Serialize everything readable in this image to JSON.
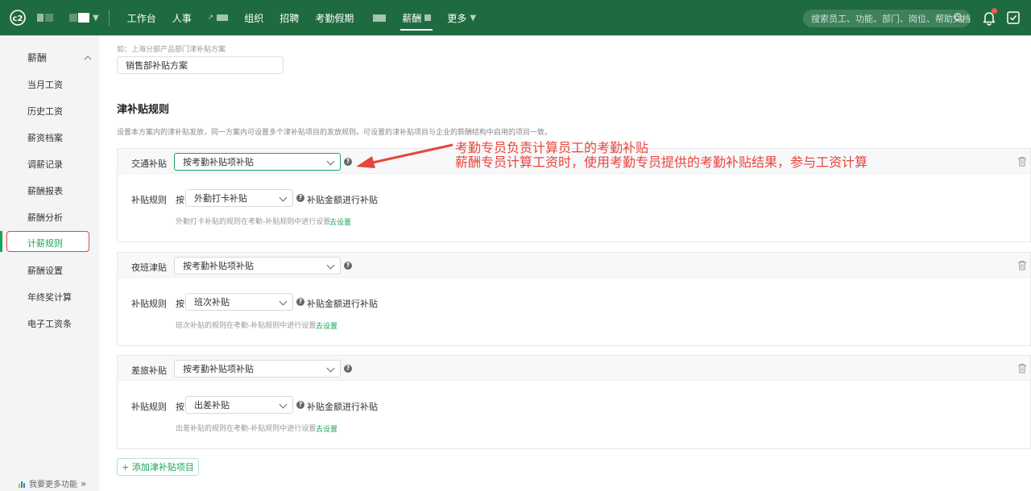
{
  "topbar": {
    "logo_text": "c2",
    "nav": [
      {
        "label": "工作台"
      },
      {
        "label": "人事"
      },
      {
        "label": "组织"
      },
      {
        "label": "招聘"
      },
      {
        "label": "考勤假期"
      },
      {
        "label": "薪酬"
      },
      {
        "label": "更多"
      }
    ],
    "search_placeholder": "搜索员工、功能、部门、岗位、帮助文档"
  },
  "sidebar": {
    "group": "薪酬",
    "items": [
      {
        "label": "当月工资"
      },
      {
        "label": "历史工资"
      },
      {
        "label": "薪资档案"
      },
      {
        "label": "调薪记录"
      },
      {
        "label": "薪酬报表"
      },
      {
        "label": "薪酬分析"
      },
      {
        "label": "计薪规则"
      },
      {
        "label": "薪酬设置"
      },
      {
        "label": "年终奖计算"
      },
      {
        "label": "电子工资条"
      }
    ],
    "bottom_link": "我要更多功能"
  },
  "main": {
    "name_hint": "如：上海分部产品部门津补贴方案",
    "name_value": "销售部补贴方案",
    "section_title": "津补贴规则",
    "section_desc": "设置本方案内的津补贴发放，同一方案内可设置多个津补贴项目的发放规则。可设置的津补贴项目与企业的薪酬结构中启用的项目一致。",
    "cards": [
      {
        "label": "交通补贴",
        "source": "按考勤补贴项补贴",
        "rule_label": "补贴规则",
        "by": "按",
        "rule_value": "外勤打卡补贴",
        "rule_after": "补贴金额进行补贴",
        "note": "外勤打卡补贴的规则在考勤-补贴规则中进行设置",
        "link": "去设置"
      },
      {
        "label": "夜班津贴",
        "source": "按考勤补贴项补贴",
        "rule_label": "补贴规则",
        "by": "按",
        "rule_value": "班次补贴",
        "rule_after": "补贴金额进行补贴",
        "note": "班次补贴的规则在考勤-补贴规则中进行设置",
        "link": "去设置"
      },
      {
        "label": "差旅补贴",
        "source": "按考勤补贴项补贴",
        "rule_label": "补贴规则",
        "by": "按",
        "rule_value": "出差补贴",
        "rule_after": "补贴金额进行补贴",
        "note": "出差补贴的规则在考勤-补贴规则中进行设置",
        "link": "去设置"
      }
    ],
    "add_button": "+ 添加津补贴项目"
  },
  "annotation": {
    "line1": "考勤专员负责计算员工的考勤补贴",
    "line2": "薪酬专员计算工资时，使用考勤专员提供的考勤补贴结果，参与工资计算"
  },
  "colors": {
    "brand": "#1e6b3f",
    "accent": "#1aa55b",
    "annotation": "#e8453c"
  }
}
